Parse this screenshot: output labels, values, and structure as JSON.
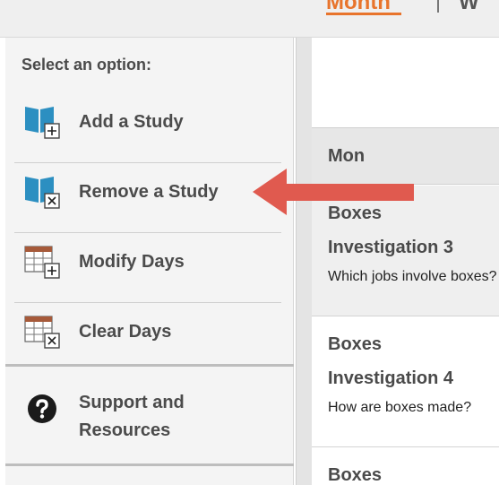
{
  "view_tabs": {
    "active": "Month",
    "next": "W"
  },
  "panel": {
    "title": "Select an option:",
    "options": [
      {
        "label": "Add a Study",
        "icon": "book-add-icon"
      },
      {
        "label": "Remove a Study",
        "icon": "book-remove-icon"
      },
      {
        "label": "Modify Days",
        "icon": "calendar-add-icon"
      },
      {
        "label": "Clear Days",
        "icon": "calendar-clear-icon"
      }
    ],
    "support": {
      "line1": "Support and",
      "line2": "Resources",
      "icon": "question-circle-icon"
    }
  },
  "calendar": {
    "day": "Mon",
    "entries": [
      {
        "study": "Boxes",
        "investigation": "Investigation 3",
        "question": "Which jobs involve boxes?"
      },
      {
        "study": "Boxes",
        "investigation": "Investigation 4",
        "question": "How are boxes made?"
      },
      {
        "study": "Boxes"
      }
    ]
  },
  "colors": {
    "accent": "#e8742c",
    "book_icon": "#2c8fc1",
    "calendar_icon": "#a65a3a",
    "arrow": "#e05a4f"
  }
}
